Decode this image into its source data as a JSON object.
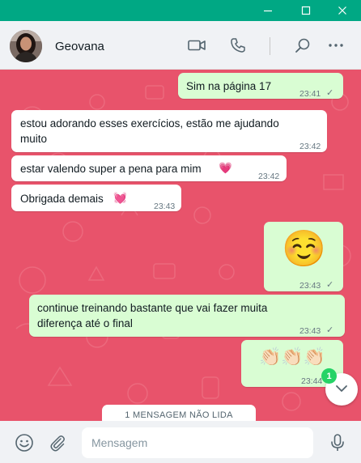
{
  "window": {
    "icons": [
      "minimize-icon",
      "maximize-icon",
      "close-icon"
    ]
  },
  "header": {
    "contact_name": "Geovana",
    "icons": [
      "video-call-icon",
      "phone-icon",
      "search-icon",
      "more-options-icon"
    ]
  },
  "colors": {
    "titlebar": "#00a884",
    "chat_background": "#e8536b",
    "incoming_bubble": "#ffffff",
    "outgoing_bubble": "#d9fdd3",
    "unread_badge": "#25d366"
  },
  "messages": [
    {
      "direction": "out",
      "text": "Sim na página 17",
      "time": "23:41",
      "status": "sent-check"
    },
    {
      "direction": "in",
      "text": "estou adorando esses exercícios, estão me ajudando muito",
      "time": "23:42"
    },
    {
      "direction": "in",
      "text": "estar valendo super a pena para mim",
      "emoji": "💗",
      "time": "23:42"
    },
    {
      "direction": "in",
      "text": "Obrigada demais",
      "emoji": "💓",
      "time": "23:43"
    },
    {
      "direction": "out",
      "emoji": "☺️",
      "time": "23:43",
      "status": "sent-check"
    },
    {
      "direction": "out",
      "text": "continue treinando bastante que vai fazer muita diferença até o final",
      "time": "23:43",
      "status": "sent-check"
    },
    {
      "direction": "out",
      "emoji": "👏🏻👏🏻👏🏻",
      "time": "23:44"
    }
  ],
  "unread": {
    "badge_count": "1",
    "banner": "1 MENSAGEM NÃO LIDA"
  },
  "composer": {
    "placeholder": "Mensagem",
    "value": "",
    "icons": [
      "emoji-icon",
      "attach-icon",
      "microphone-icon"
    ]
  }
}
